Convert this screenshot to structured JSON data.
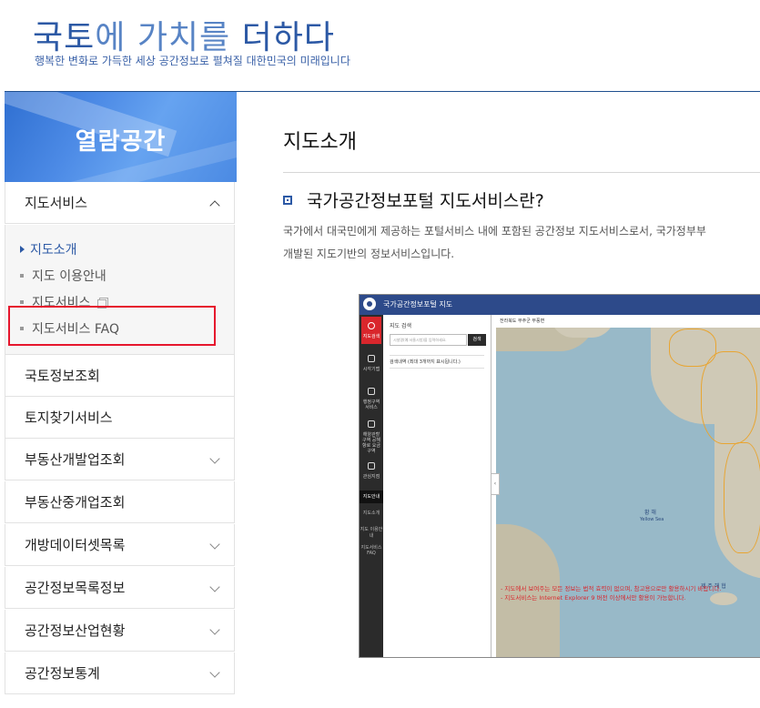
{
  "banner": {
    "slogan_part1": "국토",
    "slogan_part2": "에 가치를 ",
    "slogan_part3": "더하다",
    "subline": "행복한 변화로 가득한 세상 공간정보로 펼쳐질 대한민국의 미래입니다"
  },
  "sidebar": {
    "title": "열람공간",
    "items": [
      {
        "label": "지도서비스",
        "expanded": true
      },
      {
        "label": "국토정보조회"
      },
      {
        "label": "토지찾기서비스"
      },
      {
        "label": "부동산개발업조회"
      },
      {
        "label": "부동산중개업조회"
      },
      {
        "label": "개방데이터셋목록"
      },
      {
        "label": "공간정보목록정보"
      },
      {
        "label": "공간정보산업현황"
      },
      {
        "label": "공간정보통계"
      }
    ],
    "subitems": [
      {
        "label": "지도소개",
        "active": true
      },
      {
        "label": "지도 이용안내"
      },
      {
        "label": "지도서비스"
      },
      {
        "label": "지도서비스 FAQ"
      }
    ],
    "highlight_color": "#e6162d"
  },
  "main": {
    "page_title": "지도소개",
    "section_title": "국가공간정보포털 지도서비스란?",
    "paragraph_line1": "국가에서 대국민에게 제공하는 포털서비스 내에 포함된 공간정보 지도서비스로서, 국가정부부",
    "paragraph_line2": "개발된 지도기반의 정보서비스입니다."
  },
  "screenshot": {
    "header_title": "국가공간정보포털   지도",
    "rail": [
      "지도검색",
      "시각기맵",
      "행정구역서비스",
      "해양관할구역 공해항로 요금구역",
      "관심지점"
    ],
    "rail_links": [
      "지도안내",
      "지도소개",
      "지도 이용안내",
      "지도서비스 FAQ"
    ],
    "panel_label": "지도 검색",
    "search_placeholder": "시설명(예:서울시청)을 입력하세요.",
    "search_button": "검색",
    "result_label": "검색내역 (최대 3개까지 표시됩니다.)",
    "map_select": "전라북도 무주군 무풍면",
    "sea_label": "황 해",
    "sea_label_en": "Yellow Sea",
    "island_label": "제 주 해 협",
    "notice_line1": "- 지도에서 보여주는 모든 정보는 법적 효력이 없으며, 참고용으로만 활용하시기 바랍니다.",
    "notice_line2": "- 지도서비스는 Internet Explorer 9 버전 이상에서만 활용이 가능합니다."
  },
  "colors": {
    "brand": "#2c59a5",
    "slogan_light": "#5884c5",
    "header_dark": "#2d4a8a",
    "accent_red": "#d9262c"
  }
}
